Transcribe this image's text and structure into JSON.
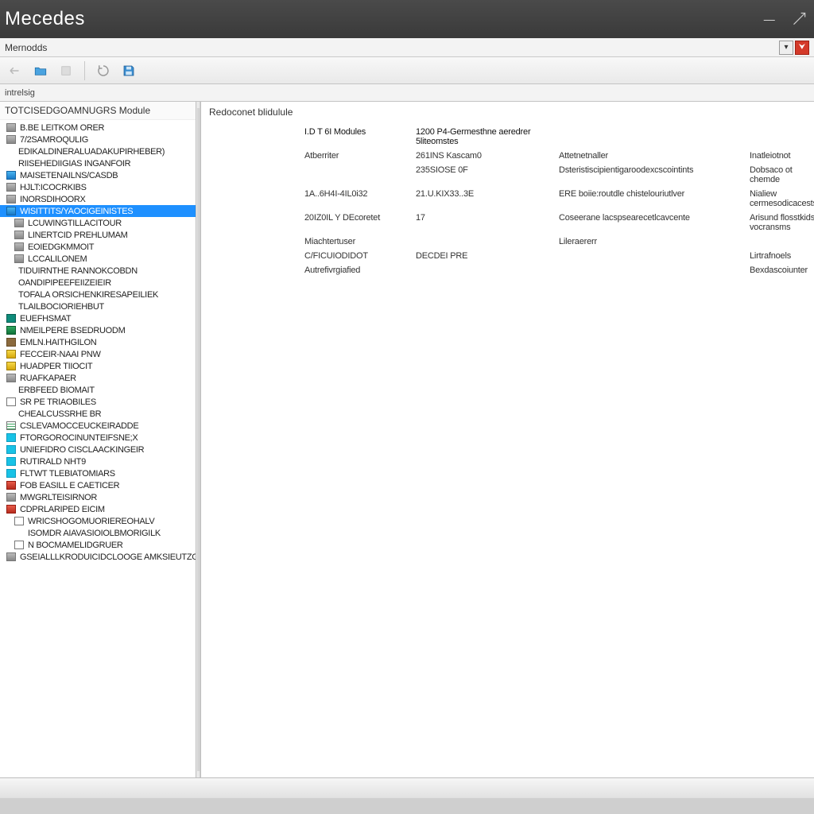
{
  "title": "Mecedes",
  "menubar": {
    "label": "Mernodds",
    "dropdown_marker": "▾",
    "pdf_marker": "⮟"
  },
  "breadcrumb": "intrelsig",
  "sidebar": {
    "header": "TOTCISEDGOAMNUGRS Module",
    "items": [
      {
        "icon": "ic-gray",
        "label": "B.BE LEITKOM ORER",
        "lvl": 0
      },
      {
        "icon": "ic-gray",
        "label": "7/2SAMROQULIG",
        "lvl": 0
      },
      {
        "icon": "ic-none",
        "label": "EDIKALDINERALUADAKUPIRHEBER)",
        "lvl": 1
      },
      {
        "icon": "ic-none",
        "label": "RIISEHEDIIGIAS INGANFOIR",
        "lvl": 1
      },
      {
        "icon": "ic-blue",
        "label": "MAISETENAILNS/CASDB",
        "lvl": 0
      },
      {
        "icon": "ic-gray",
        "label": "HJLT:ICOCRKIBS",
        "lvl": 0
      },
      {
        "icon": "ic-gray",
        "label": "INORSDIHOORX",
        "lvl": 0
      },
      {
        "icon": "ic-blue",
        "label": "WISITTITS/YAOCIGEINISTES",
        "lvl": 0,
        "selected": true
      },
      {
        "icon": "ic-gray",
        "label": "LCUWINGTILLACITOUR",
        "lvl": 1
      },
      {
        "icon": "ic-gray",
        "label": "LINERTCID PREHLUMAM",
        "lvl": 1
      },
      {
        "icon": "ic-gray",
        "label": "EOIEDGKMMOIT",
        "lvl": 1
      },
      {
        "icon": "ic-gray",
        "label": "LCCALILONEM",
        "lvl": 1
      },
      {
        "icon": "ic-none",
        "label": "TIDUIRNTHE RANNOKCOBDN",
        "lvl": 1
      },
      {
        "icon": "ic-none",
        "label": "OANDIPIPEEFEIIZEIEIR",
        "lvl": 1
      },
      {
        "icon": "ic-none",
        "label": "TOFALA ORSICHENKIRESAPEILIEK",
        "lvl": 1
      },
      {
        "icon": "ic-none",
        "label": "TLAILBOCIORIEHBUT",
        "lvl": 1
      },
      {
        "icon": "ic-teal",
        "label": "EUEFHSMAT",
        "lvl": 0
      },
      {
        "icon": "ic-green",
        "label": "NMEILPERE BSEDRUODM",
        "lvl": 0
      },
      {
        "icon": "ic-brown",
        "label": "EMLN.HAITHGILON",
        "lvl": 0
      },
      {
        "icon": "ic-yellow",
        "label": "FECCEIR-NAAI PNW",
        "lvl": 0
      },
      {
        "icon": "ic-yellow",
        "label": "HUADPER TIIOCIT",
        "lvl": 0
      },
      {
        "icon": "ic-gray",
        "label": "RUAFKAPAER",
        "lvl": 0
      },
      {
        "icon": "ic-none",
        "label": "ERBFEED BIOMAIT",
        "lvl": 1
      },
      {
        "icon": "ic-outline",
        "label": "SR PE TRIAOBILES",
        "lvl": 0
      },
      {
        "icon": "ic-none",
        "label": "CHEALCUSSRHE BR",
        "lvl": 1
      },
      {
        "icon": "ic-lines",
        "label": "CSLEVAMOCCEUCKEIRADDE",
        "lvl": 0
      },
      {
        "icon": "ic-cyan",
        "label": "FTORGOROCINUNTEIFSNE;X",
        "lvl": 0
      },
      {
        "icon": "ic-cyan",
        "label": "UNIEFIDRO CISCLAACKINGEIR",
        "lvl": 0
      },
      {
        "icon": "ic-cyan",
        "label": "RUTIRALD NHT9",
        "lvl": 0
      },
      {
        "icon": "ic-cyan",
        "label": "FLTWT TLEBIATOMIARS",
        "lvl": 0
      },
      {
        "icon": "ic-red",
        "label": "FOB EASILL E CAETICER",
        "lvl": 0
      },
      {
        "icon": "ic-gray",
        "label": "MWGRLTEISIRNOR",
        "lvl": 0
      },
      {
        "icon": "ic-red",
        "label": "CDPRLARIPED EICIM",
        "lvl": 0
      },
      {
        "icon": "ic-outline",
        "label": "WRICSHOGOMUORIEREOHALV",
        "lvl": 1
      },
      {
        "icon": "ic-none",
        "label": "ISOMDR AIAVASIOIOLBMORIGILK",
        "lvl": 2
      },
      {
        "icon": "ic-outline",
        "label": "N BOCMAMELIDGRUER",
        "lvl": 1
      },
      {
        "icon": "ic-gray",
        "label": "GSEIALLLKRODUICIDCLOOGE AMKSIEUTZG",
        "lvl": 0
      }
    ]
  },
  "detail": {
    "header": "Redoconet blidulule",
    "rows": [
      [
        "I.D T 6I Modules",
        "1200 P4-Germesthne aeredrer 5liteomstes",
        "",
        ""
      ],
      [
        "Atberriter",
        "261INS Kascam0",
        "Attetnetnaller",
        "Inatleiotnot"
      ],
      [
        "",
        "235SIOSE 0F",
        "Dsteristiscipientigaroodexcscointints",
        "Dobsaco ot chemde"
      ],
      [
        "1A..6H4I-4IL0i32",
        "21.U.KIX33..3E",
        "ERE boiie:routdle chistelouriutlver",
        "Nialiew cermesodicacests"
      ],
      [
        "20IZ0IL Y DEcoretet",
        "17",
        "Coseerane lacspsearecetlcavcente",
        "Arisund flosstkidsi vocransms"
      ],
      [
        "Miachtertuser",
        "",
        "Lileraererr",
        ""
      ],
      [
        "C/FICUIODIDOT",
        "DECDEI PRE",
        "",
        "Lirtrafnoels"
      ],
      [
        "Autrefivrgiafied",
        "",
        "",
        "Bexdascoiunter"
      ]
    ]
  }
}
